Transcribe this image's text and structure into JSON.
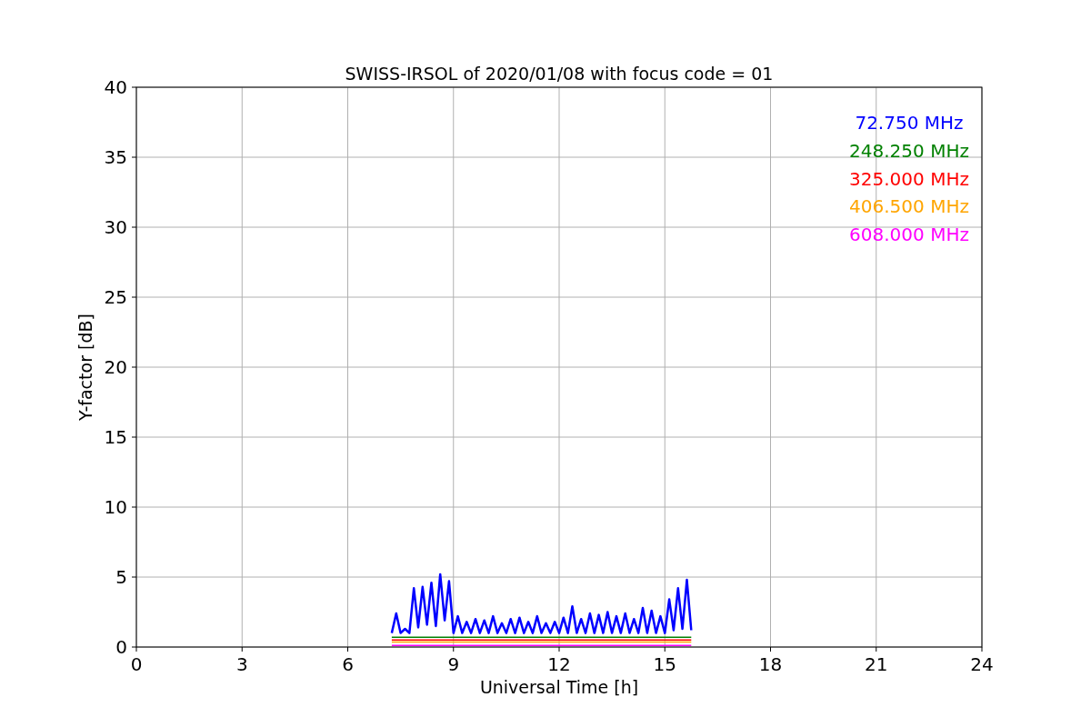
{
  "chart_data": {
    "type": "line",
    "title": "SWISS-IRSOL of 2020/01/08 with focus code = 01",
    "xlabel": "Universal Time [h]",
    "ylabel": "Y-factor [dB]",
    "grid": true,
    "xlim": [
      0,
      24
    ],
    "ylim": [
      0,
      40
    ],
    "xticks": [
      0,
      3,
      6,
      9,
      12,
      15,
      18,
      21,
      24
    ],
    "yticks": [
      0,
      5,
      10,
      15,
      20,
      25,
      30,
      35,
      40
    ],
    "x": [
      7.25,
      7.375,
      7.5,
      7.625,
      7.75,
      7.875,
      8.0,
      8.125,
      8.25,
      8.375,
      8.5,
      8.625,
      8.75,
      8.875,
      9.0,
      9.125,
      9.25,
      9.375,
      9.5,
      9.625,
      9.75,
      9.875,
      10.0,
      10.125,
      10.25,
      10.375,
      10.5,
      10.625,
      10.75,
      10.875,
      11.0,
      11.125,
      11.25,
      11.375,
      11.5,
      11.625,
      11.75,
      11.875,
      12.0,
      12.125,
      12.25,
      12.375,
      12.5,
      12.625,
      12.75,
      12.875,
      13.0,
      13.125,
      13.25,
      13.375,
      13.5,
      13.625,
      13.75,
      13.875,
      14.0,
      14.125,
      14.25,
      14.375,
      14.5,
      14.625,
      14.75,
      14.875,
      15.0,
      15.125,
      15.25,
      15.375,
      15.5,
      15.625,
      15.75
    ],
    "series": [
      {
        "name": "72.750 MHz",
        "color": "#0000ff",
        "values": [
          1.0,
          2.4,
          1.0,
          1.3,
          1.0,
          4.2,
          1.4,
          4.3,
          1.6,
          4.6,
          1.5,
          5.2,
          1.9,
          4.7,
          1.0,
          2.2,
          1.0,
          1.8,
          1.0,
          2.0,
          1.0,
          1.9,
          1.0,
          2.2,
          1.0,
          1.7,
          1.0,
          2.0,
          1.0,
          2.1,
          1.0,
          1.8,
          1.0,
          2.2,
          1.0,
          1.7,
          1.0,
          1.8,
          1.0,
          2.1,
          1.0,
          2.9,
          1.0,
          2.0,
          1.0,
          2.4,
          1.0,
          2.3,
          1.0,
          2.5,
          1.0,
          2.2,
          1.0,
          2.4,
          1.0,
          2.0,
          1.0,
          2.8,
          1.0,
          2.6,
          1.0,
          2.2,
          1.0,
          3.4,
          1.2,
          4.2,
          1.3,
          4.8,
          1.2
        ]
      },
      {
        "name": "248.250 MHz",
        "color": "#008000",
        "values": [
          0.7,
          0.7,
          0.7,
          0.7,
          0.7,
          0.7,
          0.7,
          0.7,
          0.7,
          0.7,
          0.7,
          0.7,
          0.7,
          0.7,
          0.7,
          0.7,
          0.7,
          0.7,
          0.7,
          0.7,
          0.7,
          0.7,
          0.7,
          0.7,
          0.7,
          0.7,
          0.7,
          0.7,
          0.7,
          0.7,
          0.7,
          0.7,
          0.7,
          0.7,
          0.7,
          0.7,
          0.7,
          0.7,
          0.7,
          0.7,
          0.7,
          0.7,
          0.7,
          0.7,
          0.7,
          0.7,
          0.7,
          0.7,
          0.7,
          0.7,
          0.7,
          0.7,
          0.7,
          0.7,
          0.7,
          0.7,
          0.7,
          0.7,
          0.7,
          0.7,
          0.7,
          0.7,
          0.7,
          0.7,
          0.7,
          0.7,
          0.7,
          0.7,
          0.7
        ]
      },
      {
        "name": "325.000 MHz",
        "color": "#ff0000",
        "values": [
          0.5,
          0.5,
          0.5,
          0.5,
          0.5,
          0.5,
          0.5,
          0.5,
          0.5,
          0.5,
          0.5,
          0.5,
          0.5,
          0.5,
          0.5,
          0.5,
          0.5,
          0.5,
          0.5,
          0.5,
          0.5,
          0.5,
          0.5,
          0.5,
          0.5,
          0.5,
          0.5,
          0.5,
          0.5,
          0.5,
          0.5,
          0.5,
          0.5,
          0.5,
          0.5,
          0.5,
          0.5,
          0.5,
          0.5,
          0.5,
          0.5,
          0.5,
          0.5,
          0.5,
          0.5,
          0.5,
          0.5,
          0.5,
          0.5,
          0.5,
          0.5,
          0.5,
          0.5,
          0.5,
          0.5,
          0.5,
          0.5,
          0.5,
          0.5,
          0.5,
          0.5,
          0.5,
          0.5,
          0.5,
          0.5,
          0.5,
          0.5,
          0.5,
          0.5
        ]
      },
      {
        "name": "406.500 MHz",
        "color": "#ffa500",
        "values": [
          0.35,
          0.35,
          0.35,
          0.35,
          0.35,
          0.35,
          0.35,
          0.35,
          0.35,
          0.35,
          0.35,
          0.35,
          0.35,
          0.35,
          0.35,
          0.35,
          0.35,
          0.35,
          0.35,
          0.35,
          0.35,
          0.35,
          0.35,
          0.35,
          0.35,
          0.35,
          0.35,
          0.35,
          0.35,
          0.35,
          0.35,
          0.35,
          0.35,
          0.35,
          0.35,
          0.35,
          0.35,
          0.35,
          0.35,
          0.35,
          0.35,
          0.35,
          0.35,
          0.35,
          0.35,
          0.35,
          0.35,
          0.35,
          0.35,
          0.35,
          0.35,
          0.35,
          0.35,
          0.35,
          0.35,
          0.35,
          0.35,
          0.35,
          0.35,
          0.35,
          0.35,
          0.35,
          0.35,
          0.35,
          0.35,
          0.35,
          0.35,
          0.35,
          0.35
        ]
      },
      {
        "name": "608.000 MHz",
        "color": "#ff00ff",
        "values": [
          0.12,
          0.12,
          0.12,
          0.12,
          0.12,
          0.12,
          0.12,
          0.12,
          0.12,
          0.12,
          0.12,
          0.12,
          0.12,
          0.12,
          0.12,
          0.12,
          0.12,
          0.12,
          0.12,
          0.12,
          0.12,
          0.12,
          0.12,
          0.12,
          0.12,
          0.12,
          0.12,
          0.12,
          0.12,
          0.12,
          0.12,
          0.12,
          0.12,
          0.12,
          0.12,
          0.12,
          0.12,
          0.12,
          0.12,
          0.12,
          0.12,
          0.12,
          0.12,
          0.12,
          0.12,
          0.12,
          0.12,
          0.12,
          0.12,
          0.12,
          0.12,
          0.12,
          0.12,
          0.12,
          0.12,
          0.12,
          0.12,
          0.12,
          0.12,
          0.12,
          0.12,
          0.12,
          0.12,
          0.12,
          0.12,
          0.12,
          0.12,
          0.12,
          0.12
        ]
      }
    ]
  }
}
